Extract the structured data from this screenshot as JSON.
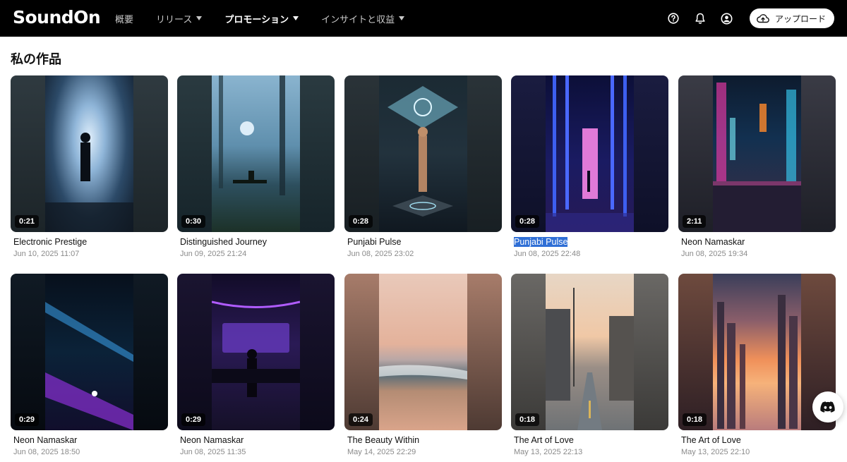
{
  "app": {
    "logo": "SoundOn"
  },
  "nav": [
    {
      "label": "概要",
      "has_caret": false,
      "active": false
    },
    {
      "label": "リリース",
      "has_caret": true,
      "active": false
    },
    {
      "label": "プロモーション",
      "has_caret": true,
      "active": true
    },
    {
      "label": "インサイトと収益",
      "has_caret": true,
      "active": false
    }
  ],
  "top_actions": {
    "upload_label": "アップロード"
  },
  "page": {
    "title": "私の作品"
  },
  "works": [
    {
      "title": "Electronic Prestige",
      "date": "Jun 10, 2025 11:07",
      "duration": "0:21",
      "theme": "room"
    },
    {
      "title": "Distinguished Journey",
      "date": "Jun 09, 2025 21:24",
      "duration": "0:30",
      "theme": "forest"
    },
    {
      "title": "Punjabi Pulse",
      "date": "Jun 08, 2025 23:02",
      "duration": "0:28",
      "theme": "robots"
    },
    {
      "title": "Punjabi Pulse",
      "date": "Jun 08, 2025 22:48",
      "duration": "0:28",
      "theme": "neonhall",
      "selected": true
    },
    {
      "title": "Neon Namaskar",
      "date": "Jun 08, 2025 19:34",
      "duration": "2:11",
      "theme": "city"
    },
    {
      "title": "Neon Namaskar",
      "date": "Jun 08, 2025 18:50",
      "duration": "0:29",
      "theme": "tunnel"
    },
    {
      "title": "Neon Namaskar",
      "date": "Jun 08, 2025 11:35",
      "duration": "0:29",
      "theme": "studio"
    },
    {
      "title": "The Beauty Within",
      "date": "May 14, 2025 22:29",
      "duration": "0:24",
      "theme": "beach"
    },
    {
      "title": "The Art of Love",
      "date": "May 13, 2025 22:13",
      "duration": "0:18",
      "theme": "street"
    },
    {
      "title": "The Art of Love",
      "date": "May 13, 2025 22:10",
      "duration": "0:18",
      "theme": "skyline"
    }
  ]
}
